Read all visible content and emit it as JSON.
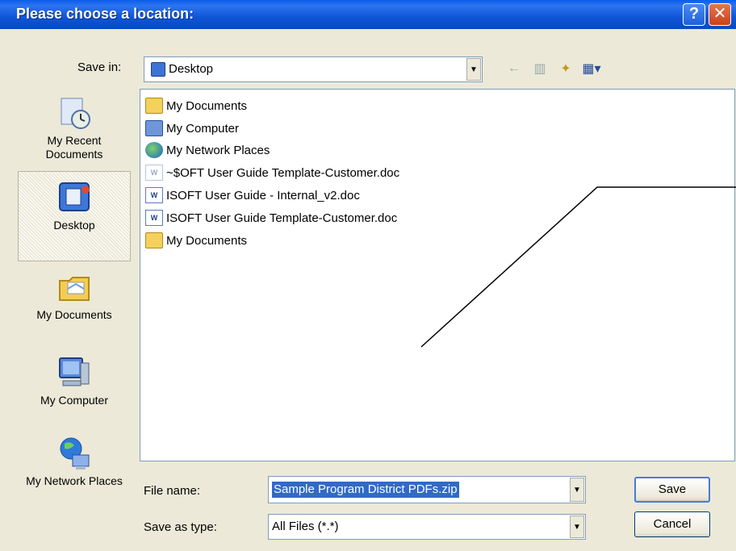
{
  "window": {
    "title": "Please choose a location:",
    "help_button": "?",
    "close_button": "✕"
  },
  "save_in": {
    "label": "Save in:",
    "value": "Desktop"
  },
  "places": [
    {
      "label": "My Recent Documents",
      "icon": "recent-documents-icon"
    },
    {
      "label": "Desktop",
      "icon": "desktop-icon"
    },
    {
      "label": "My Documents",
      "icon": "my-documents-icon"
    },
    {
      "label": "My Computer",
      "icon": "my-computer-icon"
    },
    {
      "label": "My Network Places",
      "icon": "network-places-icon"
    }
  ],
  "files": [
    {
      "name": "My Documents",
      "icon": "folder-icon"
    },
    {
      "name": "My Computer",
      "icon": "computer-icon"
    },
    {
      "name": "My Network Places",
      "icon": "network-icon"
    },
    {
      "name": "~$OFT User Guide Template-Customer.doc",
      "icon": "word-doc-icon"
    },
    {
      "name": "ISOFT User Guide - Internal_v2.doc",
      "icon": "word-doc-icon"
    },
    {
      "name": "ISOFT User Guide Template-Customer.doc",
      "icon": "word-doc-icon"
    },
    {
      "name": "My Documents",
      "icon": "folder-shortcut-icon"
    }
  ],
  "file_name": {
    "label": "File name:",
    "value": "Sample Program District PDFs.zip"
  },
  "save_as_type": {
    "label": "Save as type:",
    "value": "All Files (*.*)"
  },
  "buttons": {
    "save": "Save",
    "cancel": "Cancel"
  }
}
